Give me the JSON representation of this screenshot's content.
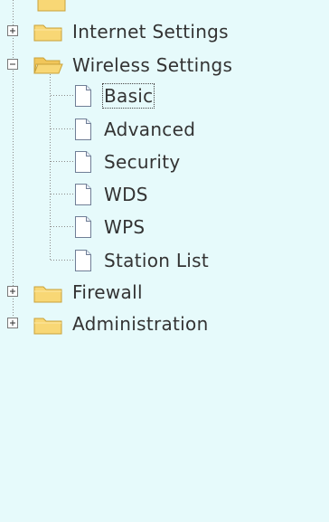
{
  "tree": {
    "nodes": [
      {
        "label": "Internet Settings",
        "state": "collapsed"
      },
      {
        "label": "Wireless Settings",
        "state": "expanded",
        "children": [
          {
            "label": "Basic",
            "selected": true
          },
          {
            "label": "Advanced"
          },
          {
            "label": "Security"
          },
          {
            "label": "WDS"
          },
          {
            "label": "WPS"
          },
          {
            "label": "Station List"
          }
        ]
      },
      {
        "label": "Firewall",
        "state": "collapsed"
      },
      {
        "label": "Administration",
        "state": "collapsed"
      }
    ]
  },
  "colors": {
    "background": "#e6fafb",
    "text": "#333333",
    "tree_line": "#8a8a8a",
    "folder_fill": "#f8d775",
    "folder_edge": "#c9a23a",
    "page_fill": "#ffffff",
    "page_edge": "#6f7e96"
  },
  "icons": {
    "collapsed_toggle": "plus-box-icon",
    "expanded_toggle": "minus-box-icon",
    "closed_folder": "folder-icon",
    "open_folder": "folder-open-icon",
    "leaf": "page-icon"
  }
}
